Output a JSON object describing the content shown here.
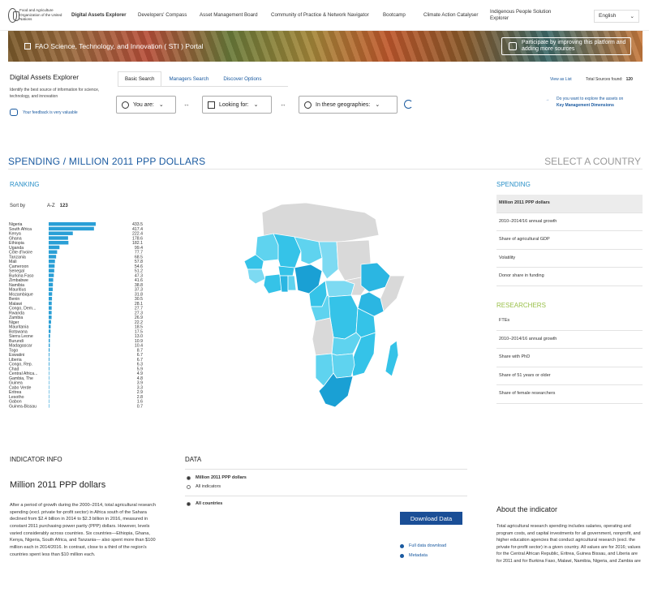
{
  "nav": {
    "logo_text": "Food and Agriculture Organization of the United Nations",
    "items": [
      {
        "label": "Digital Assets Explorer",
        "active": true
      },
      {
        "label": "Developers' Compass",
        "active": false
      },
      {
        "label": "Asset Management Board",
        "active": false
      },
      {
        "label": "Community of Practice & Network Navigator",
        "active": false
      },
      {
        "label": "Bootcamp",
        "active": false
      },
      {
        "label": "Climate Action Catalyser",
        "active": false
      },
      {
        "label": "Indigenous People Solution Explorer",
        "active": false
      }
    ],
    "language": "English",
    "language_chevron": "⌄"
  },
  "banner": {
    "title": "FAO Science, Technology, and Innovation ( STI ) Portal",
    "cta": "Participate by improving this platform and adding more sources"
  },
  "explorer": {
    "title": "Digital Assets Explorer",
    "description": "Identify the best source of information for science, technology, and innovation",
    "feedback": "Your feedback is very valuable",
    "tabs": [
      "Basic Search",
      "Managers Search",
      "Discover Options"
    ],
    "selectors": {
      "you_are": "You are:",
      "looking_for": "Looking for:",
      "geographies": "In these geographies:"
    },
    "chevron": "⌄",
    "arrow": "↔",
    "view_as_list": "View as List",
    "total_label": "Total Sources found:",
    "total_value": "120",
    "key_mgmt_arrow": "→",
    "key_mgmt_line1": "Do you want to explore the assets on",
    "key_mgmt_line2": "Key Management Dimensions"
  },
  "main": {
    "heading": "SPENDING / MILLION 2011 PPP DOLLARS",
    "select_country": "SELECT A COUNTRY",
    "ranking_label": "RANKING",
    "sort_by": "Sort by",
    "sort_az": "A-Z",
    "sort_num": "123"
  },
  "chart_data": {
    "type": "bar",
    "orientation": "horizontal",
    "title": "Spending / Million 2011 PPP dollars",
    "color": "#2a9fd6",
    "categories": [
      "Nigeria",
      "South Africa",
      "Kenya",
      "Ghana",
      "Ethiopia",
      "Uganda",
      "Côte d'Ivoire",
      "Tanzania",
      "Mali",
      "Cameroon",
      "Senegal",
      "Burkina Faso",
      "Zimbabwe",
      "Namibia",
      "Mauritius",
      "Mozambique",
      "Benin",
      "Malawi",
      "Congo, Dem...",
      "Rwanda",
      "Zambia",
      "Niger",
      "Mauritania",
      "Botswana",
      "Sierra Leone",
      "Burundi",
      "Madagascar",
      "Togo",
      "Eswatini",
      "Liberia",
      "Congo, Rep.",
      "Chad",
      "Central Africa...",
      "Gambia, The",
      "Guinea",
      "Cabo Verde",
      "Eritrea",
      "Lesotho",
      "Gabon",
      "Guinea-Bissau"
    ],
    "values": [
      433.5,
      417.4,
      222.4,
      178.6,
      182.1,
      99.4,
      77.7,
      68.5,
      57.8,
      54.6,
      51.2,
      47.3,
      41.6,
      38.8,
      37.3,
      31.8,
      30.5,
      28.1,
      27.7,
      27.3,
      26.9,
      22.2,
      18.5,
      17.5,
      13.0,
      10.9,
      10.4,
      8.7,
      6.7,
      6.7,
      6.3,
      5.9,
      4.9,
      4.8,
      3.9,
      3.3,
      2.9,
      2.8,
      1.6,
      0.7
    ],
    "value_labels": [
      "433.5",
      "417.4",
      "222.4",
      "178.6",
      "182.1",
      "99.4",
      "77.7",
      "68.5",
      "57.8",
      "54.6",
      "51.2",
      "47.3",
      "41.6",
      "38.8",
      "37.3",
      "31.8",
      "30.5",
      "28.1",
      "27.7",
      "27.3",
      "26.9",
      "22.2",
      "18.5",
      "17.5",
      "13.0",
      "10.9",
      "10.4",
      "8.7",
      "6.7",
      "6.7",
      "6.3",
      "5.9",
      "4.9",
      "4.8",
      "3.9",
      "3.3",
      "2.9",
      "2.8",
      "1.6",
      "0.7"
    ],
    "xlim": [
      0,
      433.5
    ]
  },
  "map": {
    "colors": {
      "highest": "#1aa0d4",
      "high": "#2bb6e2",
      "mid": "#35c3e8",
      "low": "#5fd3ef",
      "lowest": "#7ddaf2",
      "nodata": "#d9d9d9",
      "border": "#ffffff"
    }
  },
  "right": {
    "spending_label": "SPENDING",
    "spending_items": [
      "Million 2011 PPP dollars",
      "2010–2014/16 annual growth",
      "Share of agricultural GDP",
      "Volatility",
      "Donor share in funding"
    ],
    "researchers_label": "RESEARCHERS",
    "researcher_items": [
      "FTEs",
      "2010–2014/16 annual growth",
      "Share with PhD",
      "Share of 51 years or older",
      "Share of female researchers"
    ]
  },
  "indicator": {
    "label": "INDICATOR INFO",
    "title": "Million 2011 PPP dollars",
    "text": "After a period of growth during the 2000–2014, total agricultural research spending (excl. private for-profit sector) in Africa south of the Sahara declined from $2.4 billion in 2014 to $2.3 billion in 2016, measured in constant 2011 purchasing power parity (PPP) dollars. However, levels varied considerably across countries. Six countries—Ethiopia, Ghana, Kenya, Nigeria, South Africa, and Tanzania— also spent more than $100 million each in 2014/2016. In contrast, close to a third of the region's countries spent less than $10 million each."
  },
  "data_panel": {
    "label": "DATA",
    "radio1": "Million 2011 PPP dollars",
    "radio2": "All indicators",
    "radio3": "All countries",
    "download": "Download Data",
    "full_download": "Full data download",
    "metadata": "Metadata"
  },
  "about": {
    "title": "About the indicator",
    "text": "Total agricultural research spending includes salaries, operating and program costs, and capital investments for all government, nonprofit, and higher education agencies that conduct agricultural research (excl. the private for-profit sector) in a given country. All values are for 2016; values for the Central African Republic, Eritrea, Guinea Bissau, and Liberia are for 2011 and for Burkina Faso, Malawi, Namibia, Nigeria, and Zambia are"
  }
}
